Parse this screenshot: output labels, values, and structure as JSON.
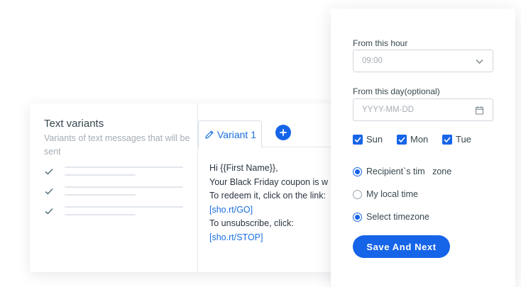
{
  "text_variants": {
    "title": "Text variants",
    "subtitle": "Variants of text messages that will be sent",
    "active_tab": "Variant 1"
  },
  "message": {
    "lines": [
      "Hi {{First Name}},",
      "Your Black Friday coupon is w",
      "To redeem it, click on the link:",
      "[sho.rt/GO]",
      "To unsubscribe, click:",
      "[sho.rt/STOP]"
    ]
  },
  "schedule": {
    "hour_label": "From this hour",
    "hour_value": "09:00",
    "day_label": "From this day(optional)",
    "day_placeholder": "YYYY-MM-DD",
    "days": [
      {
        "label": "Sun",
        "checked": true
      },
      {
        "label": "Mon",
        "checked": true
      },
      {
        "label": "Tue",
        "checked": true
      }
    ],
    "timezone_options": [
      {
        "label": "Recipient`s tim   zone",
        "selected": true
      },
      {
        "label": "My local time",
        "selected": false
      },
      {
        "label": "Select timezone",
        "selected": true
      }
    ],
    "save_label": "Save And Next"
  },
  "colors": {
    "accent": "#1664e8",
    "link": "#1a6fe0",
    "muted_text": "#a5adb5"
  }
}
